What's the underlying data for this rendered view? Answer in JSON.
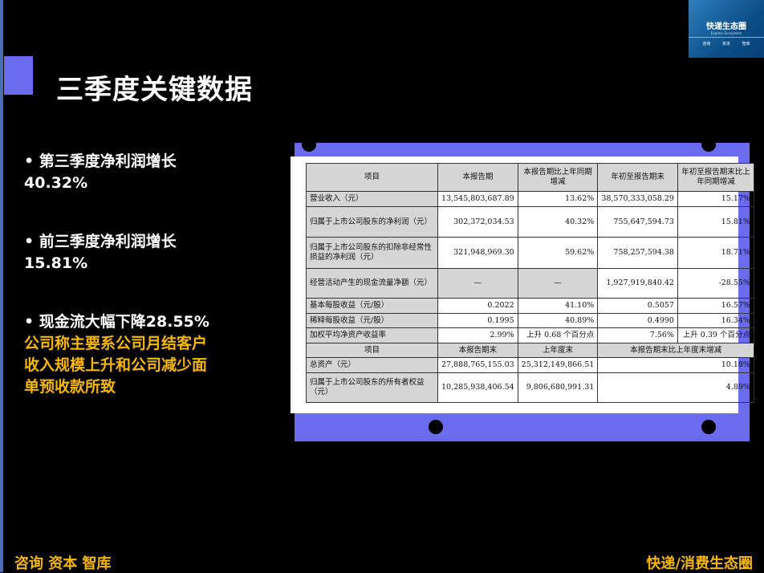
{
  "title": "三季度关键数据",
  "logo": {
    "name": "快递生态圈",
    "subtitle": "Express Ecosystem",
    "tags": [
      "咨询",
      "资本",
      "智库"
    ]
  },
  "bullets": [
    {
      "lines": [
        "•  第三季度净利润增长",
        "40.32%"
      ],
      "extra": []
    },
    {
      "lines": [
        "•  前三季度净利润增长",
        "15.81%"
      ],
      "extra": []
    },
    {
      "lines": [
        "•  现金流大幅下降28.55%"
      ],
      "extra": [
        "公司称主要系公司月结客户",
        "收入规模上升和公司减少面",
        "单预收款所致"
      ]
    }
  ],
  "table": {
    "headers": [
      "项目",
      "本报告期",
      "本报告期比上年同期增减",
      "年初至报告期末",
      "年初至报告期末比上年同期增减"
    ],
    "rows": [
      [
        "营业收入（元）",
        "13,545,803,687.89",
        "13.62%",
        "38,570,333,058.29",
        "15.17%"
      ],
      [
        "归属于上市公司股东的净利润（元）",
        "302,372,034.53",
        "40.32%",
        "755,647,594.73",
        "15.81%"
      ],
      [
        "归属于上市公司股东的扣除非经常性损益的净利润（元）",
        "321,948,969.30",
        "59.62%",
        "758,257,594.38",
        "18.71%"
      ],
      [
        "经营活动产生的现金流量净额（元）",
        "—",
        "—",
        "1,927,919,840.42",
        "-28.55%"
      ],
      [
        "基本每股收益（元/股）",
        "0.2022",
        "41.10%",
        "0.5057",
        "16.57%"
      ],
      [
        "稀释每股收益（元/股）",
        "0.1995",
        "40.89%",
        "0.4990",
        "16.34%"
      ],
      [
        "加权平均净资产收益率",
        "2.99%",
        "上升 0.68 个百分点",
        "7.56%",
        "上升 0.39 个百分点"
      ]
    ],
    "headers2": [
      "项目",
      "本报告期末",
      "上年度末",
      "本报告期末比上年度末增减"
    ],
    "rows2": [
      [
        "总资产（元）",
        "27,888,765,155.03",
        "25,312,149,866.51",
        "10.18%"
      ],
      [
        "归属于上市公司股东的所有者权益（元）",
        "10,285,938,406.54",
        "9,806,680,991.31",
        "4.89%"
      ]
    ]
  },
  "footer": {
    "left": "咨询 资本 智库",
    "right": "快递/消费生态圈"
  }
}
